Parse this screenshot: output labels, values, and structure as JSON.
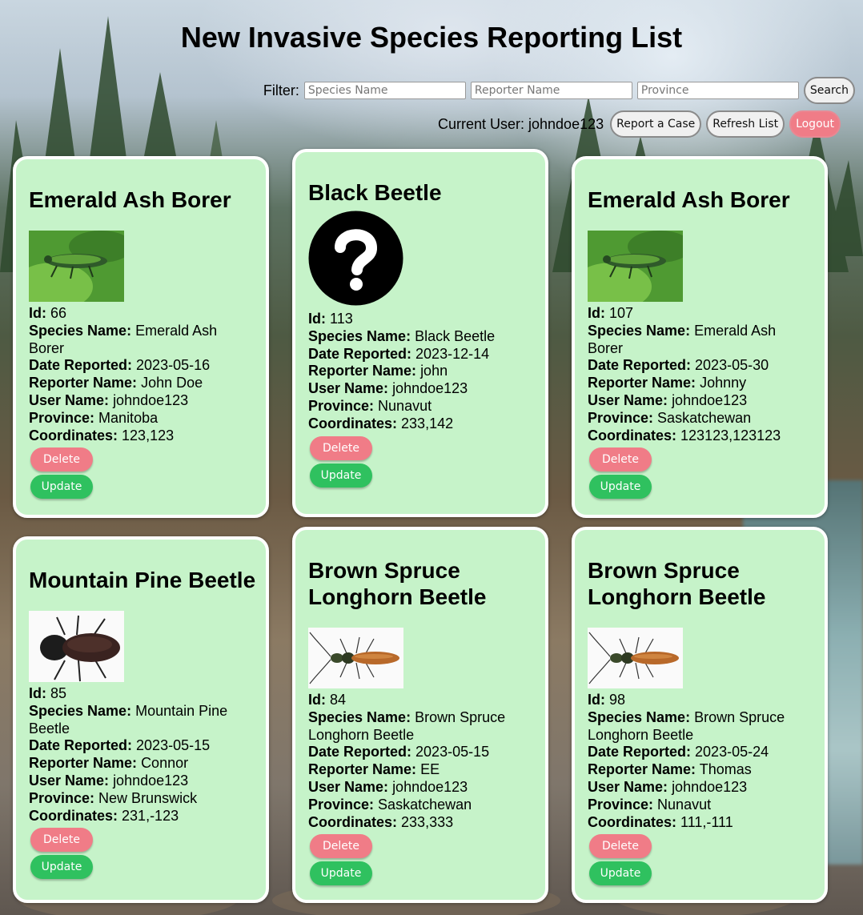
{
  "page": {
    "title": "New Invasive Species Reporting List"
  },
  "filter": {
    "label": "Filter:",
    "species_placeholder": "Species Name",
    "reporter_placeholder": "Reporter Name",
    "province_placeholder": "Province",
    "search_label": "Search"
  },
  "user_bar": {
    "current_user_label": "Current User: johndoe123",
    "report_label": "Report a Case",
    "refresh_label": "Refresh List",
    "logout_label": "Logout"
  },
  "field_labels": {
    "id": "Id:",
    "species": "Species Name:",
    "date": "Date Reported:",
    "reporter": "Reporter Name:",
    "user": "User Name:",
    "province": "Province:",
    "coords": "Coordinates:"
  },
  "buttons": {
    "delete": "Delete",
    "update": "Update"
  },
  "colors": {
    "card_bg": "#c6f3c9",
    "delete": "#f07c87",
    "update": "#2fc15f",
    "logout": "#f07c87"
  },
  "cards": [
    {
      "title": "Emerald Ash Borer",
      "image": "emerald-ash-borer",
      "id": "66",
      "species": "Emerald Ash Borer",
      "date": "2023-05-16",
      "reporter": "John Doe",
      "user": "johndoe123",
      "province": "Manitoba",
      "coords": "123,123"
    },
    {
      "title": "Black Beetle",
      "image": "question-mark-icon",
      "id": "113",
      "species": "Black Beetle",
      "date": "2023-12-14",
      "reporter": "john",
      "user": "johndoe123",
      "province": "Nunavut",
      "coords": "233,142"
    },
    {
      "title": "Emerald Ash Borer",
      "image": "emerald-ash-borer",
      "id": "107",
      "species": "Emerald Ash Borer",
      "date": "2023-05-30",
      "reporter": "Johnny",
      "user": "johndoe123",
      "province": "Saskatchewan",
      "coords": "123123,123123"
    },
    {
      "title": "Mountain Pine Beetle",
      "image": "mountain-pine-beetle",
      "id": "85",
      "species": "Mountain Pine Beetle",
      "date": "2023-05-15",
      "reporter": "Connor",
      "user": "johndoe123",
      "province": "New Brunswick",
      "coords": "231,-123"
    },
    {
      "title": "Brown Spruce Longhorn Beetle",
      "image": "brown-spruce-longhorn-beetle",
      "id": "84",
      "species": "Brown Spruce Longhorn Beetle",
      "date": "2023-05-15",
      "reporter": "EE",
      "user": "johndoe123",
      "province": "Saskatchewan",
      "coords": "233,333"
    },
    {
      "title": "Brown Spruce Longhorn Beetle",
      "image": "brown-spruce-longhorn-beetle",
      "id": "98",
      "species": "Brown Spruce Longhorn Beetle",
      "date": "2023-05-24",
      "reporter": "Thomas",
      "user": "johndoe123",
      "province": "Nunavut",
      "coords": "111,-111"
    }
  ]
}
